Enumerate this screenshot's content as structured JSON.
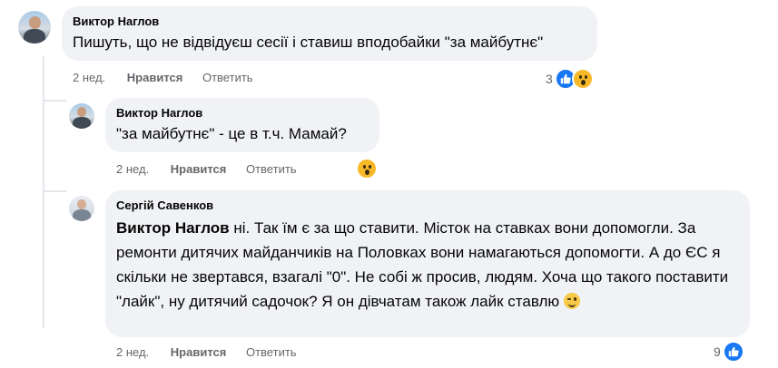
{
  "comments": [
    {
      "author": "Виктор Наглов",
      "text": "Пишуть, що не відвідуєш сесії і ставиш вподобайки \"за майбутнє\"",
      "time": "2 нед.",
      "like_label": "Нравится",
      "reply_label": "Ответить",
      "reaction_count": "3",
      "reactions": [
        "like-icon",
        "wow-icon"
      ]
    },
    {
      "author": "Виктор Наглов",
      "text": "\"за майбутнє\" - це в т.ч. Мамай?",
      "time": "2 нед.",
      "like_label": "Нравится",
      "reply_label": "Ответить",
      "reactions": [
        "wow-icon"
      ]
    },
    {
      "author": "Сергій Савенков",
      "mention": "Виктор Наглов",
      "text": " ні. Так їм є за що ставити. Місток на ставках вони допомогли. За ремонти дитячих майданчиків на Половках вони намагаються допомогти. А до ЄС я скільки не звертався, взагалі \"0\". Не собі ж просив, людям. Хоча що такого поставити \"лайк\", ну дитячий садочок? Я он дівчатам також лайк ставлю",
      "emoji": "winking-face-icon",
      "time": "2 нед.",
      "like_label": "Нравится",
      "reply_label": "Ответить",
      "reaction_count": "9",
      "reactions": [
        "like-icon"
      ]
    }
  ],
  "colors": {
    "bubble": "#f0f2f5",
    "meta_text": "#65676b",
    "like_blue": "#1877f2",
    "wow_yellow": "#f7b928"
  }
}
